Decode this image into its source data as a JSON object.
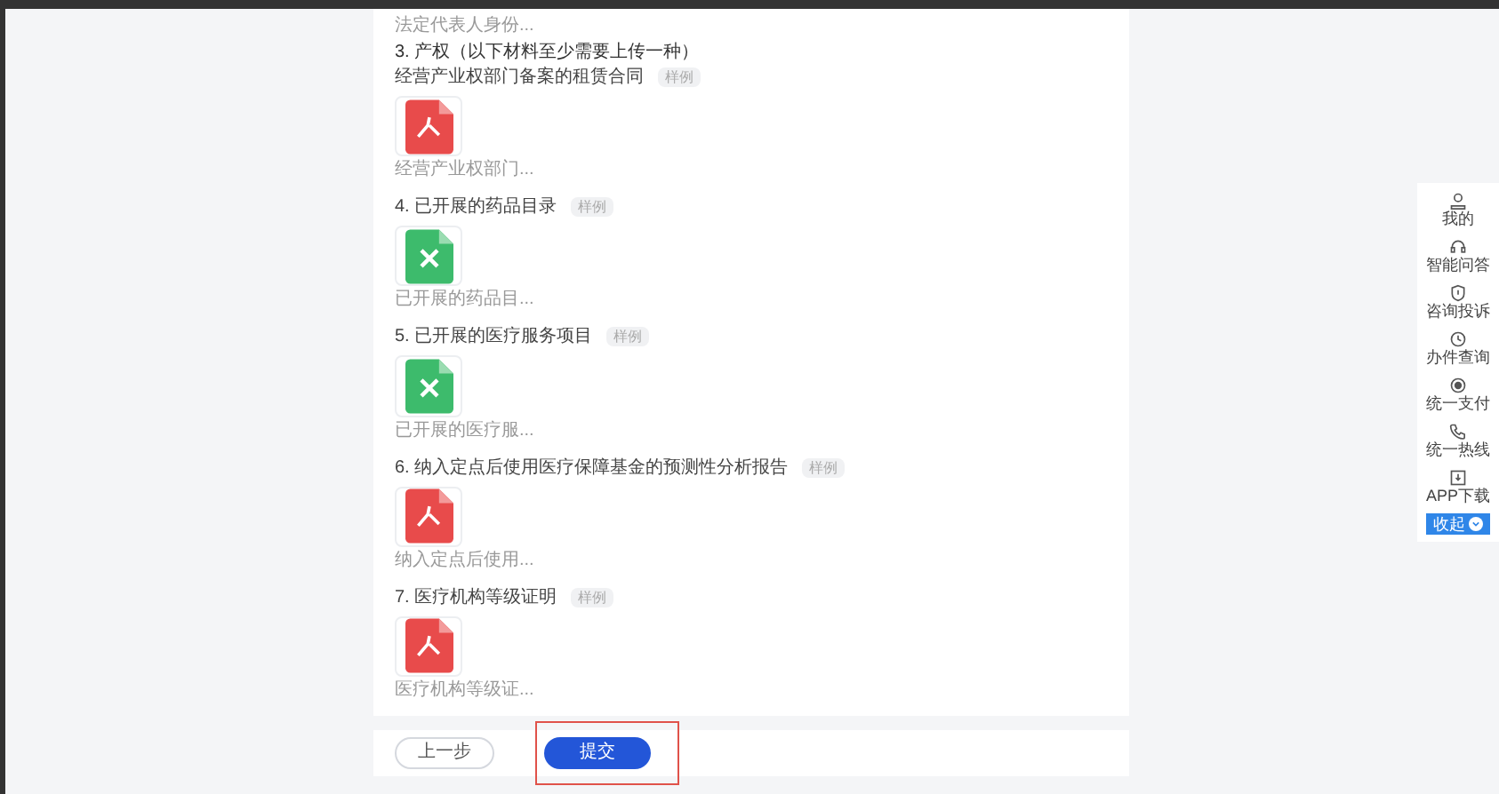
{
  "top_caption": "法定代表人身份...",
  "section_title": "3. 产权（以下材料至少需要上传一种）",
  "items": [
    {
      "title": "经营产业权部门备案的租赁合同",
      "tag": "样例",
      "file": {
        "kind": "pdf",
        "caption": "经营产业权部门..."
      }
    },
    {
      "title": "4. 已开展的药品目录",
      "tag": "样例",
      "file": {
        "kind": "xls",
        "caption": "已开展的药品目..."
      }
    },
    {
      "title": "5. 已开展的医疗服务项目",
      "tag": "样例",
      "file": {
        "kind": "xls",
        "caption": "已开展的医疗服..."
      }
    },
    {
      "title": "6. 纳入定点后使用医疗保障基金的预测性分析报告",
      "tag": "样例",
      "file": {
        "kind": "pdf",
        "caption": "纳入定点后使用..."
      }
    },
    {
      "title": "7. 医疗机构等级证明",
      "tag": "样例",
      "file": {
        "kind": "pdf",
        "caption": "医疗机构等级证..."
      }
    }
  ],
  "buttons": {
    "prev": "上一步",
    "submit": "提交"
  },
  "sidebar": {
    "items": [
      {
        "kind": "user",
        "label": "我的"
      },
      {
        "kind": "headset",
        "label": "智能问答"
      },
      {
        "kind": "shield",
        "label": "咨询投诉"
      },
      {
        "kind": "clock",
        "label": "办件查询"
      },
      {
        "kind": "coin",
        "label": "统一支付"
      },
      {
        "kind": "phone",
        "label": "统一热线"
      },
      {
        "kind": "app",
        "label": "APP下载"
      }
    ],
    "collapse": "收起"
  }
}
